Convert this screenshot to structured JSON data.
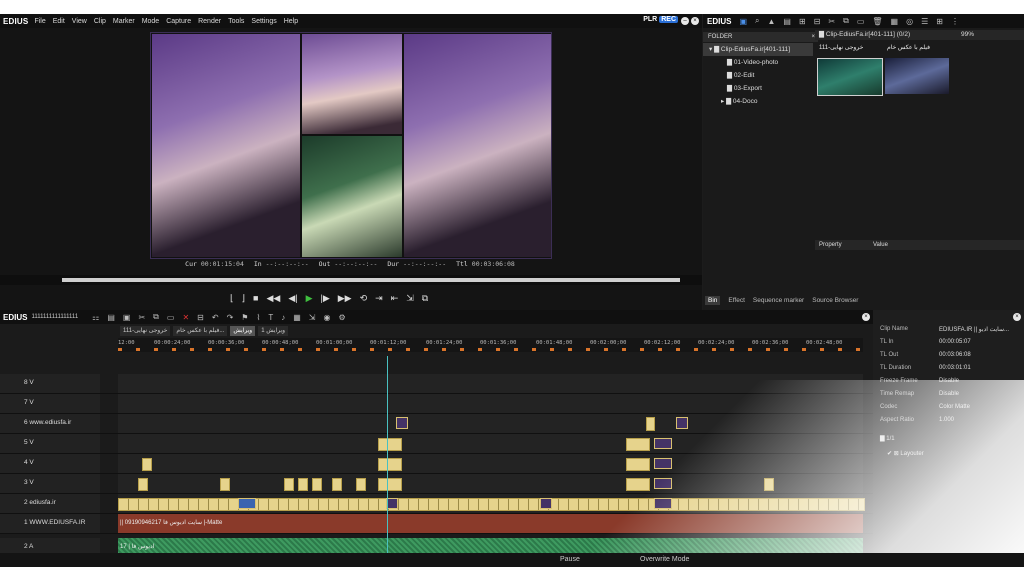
{
  "player": {
    "app_name": "EDIUS",
    "menu": [
      "File",
      "Edit",
      "View",
      "Clip",
      "Marker",
      "Mode",
      "Capture",
      "Render",
      "Tools",
      "Settings",
      "Help"
    ],
    "plr": "PLR",
    "rec": "REC",
    "timecode": {
      "cur_label": "Cur",
      "cur": "00:01:15:04",
      "in_label": "In",
      "in": "--:--:--:--",
      "out_label": "Out",
      "out": "--:--:--:--",
      "dur_label": "Dur",
      "dur": "--:--:--:--",
      "ttl_label": "Ttl",
      "ttl": "00:03:06:08"
    }
  },
  "bin": {
    "app_name": "EDIUS",
    "folder_header": "FOLDER",
    "folders": [
      "Clip-EdiusFa.ir[401-111]",
      "01-Video-photo",
      "02-Edit",
      "03-Export",
      "04-Doco"
    ],
    "clips_header": "Clip-EdiusFa.ir[401-111] (0/2)",
    "zoom": "99%",
    "clips": [
      {
        "label": "خروجی نهایی-111"
      },
      {
        "label": "فیلم با عکس خام"
      }
    ],
    "prop_header": "Property",
    "value_header": "Value",
    "tabs": [
      "Bin",
      "Effect",
      "Sequence marker",
      "Source Browser"
    ]
  },
  "timeline": {
    "app_name": "EDIUS",
    "project_name": "1111111111111111",
    "seq_tabs": [
      "خروجی نهایی-111",
      "فیلم با عکس خام...",
      "ویرایش",
      "ویرایش 1"
    ],
    "ruler": [
      "12:00",
      "00:00:24;00",
      "00:00:36;00",
      "00:00:48;00",
      "00:01:00;00",
      "00:01:12;00",
      "00:01:24;00",
      "00:01:36;00",
      "00:01:48;00",
      "00:02:00;00",
      "00:02:12;00",
      "00:02:24;00",
      "00:02:36;00",
      "00:02:48;00"
    ],
    "tracks": [
      "8 V",
      "7 V",
      "6 www.ediusfa.ir",
      "5 V",
      "4 V",
      "3 V",
      "2 ediusfa.ir",
      "1 WWW.EDIUSFA.IR",
      "2 A"
    ],
    "track1_text": "|| 09190946217 سایت ادیوس فا |-Matte",
    "track_a_text": "17 | ادیوس فا"
  },
  "info": {
    "rows": [
      {
        "k": "Clip Name",
        "v": "EDIUSFA.IR || سایت ادیو..."
      },
      {
        "k": "TL In",
        "v": "00:00:05:07"
      },
      {
        "k": "TL Out",
        "v": "00:03:06:08"
      },
      {
        "k": "TL Duration",
        "v": "00:03:01:01"
      },
      {
        "k": "Freeze Frame",
        "v": "Disable"
      },
      {
        "k": "Time Remap",
        "v": "Disable"
      },
      {
        "k": "Codec",
        "v": "Color Matte"
      },
      {
        "k": "Aspect Ratio",
        "v": "1.000"
      }
    ],
    "counter": "1/1",
    "layouter": "Layouter"
  },
  "status": {
    "pause": "Pause",
    "mode": "Overwrite Mode"
  }
}
